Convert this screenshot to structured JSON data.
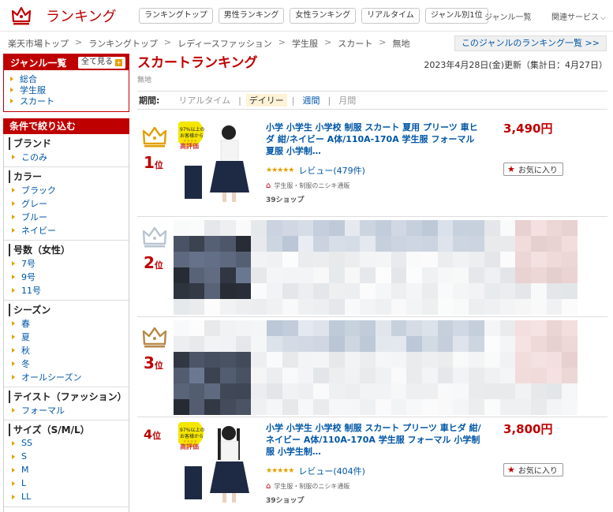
{
  "header": {
    "logo_text": "ランキング",
    "tabs": [
      "ランキングトップ",
      "男性ランキング",
      "女性ランキング",
      "リアルタイム",
      "ジャンル別1位"
    ],
    "genre_list_link": "ジャンル一覧",
    "related_services": "関連サービス"
  },
  "breadcrumb": [
    "楽天市場トップ",
    "ランキングトップ",
    "レディースファッション",
    "学生服",
    "スカート",
    "無地"
  ],
  "genre_ranking_link": "このジャンルのランキング一覧 >>",
  "sidebar": {
    "genre_title": "ジャンル一覧",
    "see_all": "全て見る",
    "genres": [
      "総合",
      "学生服",
      "スカート"
    ],
    "filter_title": "条件で絞り込む",
    "groups": [
      {
        "title": "ブランド",
        "items": [
          "このみ"
        ]
      },
      {
        "title": "カラー",
        "items": [
          "ブラック",
          "グレー",
          "ブルー",
          "ネイビー"
        ]
      },
      {
        "title": "号数（女性）",
        "items": [
          "7号",
          "9号",
          "11号"
        ]
      },
      {
        "title": "シーズン",
        "items": [
          "春",
          "夏",
          "秋",
          "冬",
          "オールシーズン"
        ]
      },
      {
        "title": "テイスト（ファッション）",
        "items": [
          "フォーマル"
        ]
      },
      {
        "title": "サイズ（S/M/L）",
        "items": [
          "SS",
          "S",
          "M",
          "L",
          "LL"
        ]
      }
    ]
  },
  "main": {
    "title": "スカートランキング",
    "updated": "2023年4月28日(金)更新（集計日：4月27日）",
    "subgenre": "無地",
    "period_label": "期間:",
    "periods": [
      "リアルタイム",
      "デイリー",
      "週間",
      "月間"
    ],
    "active_period": "デイリー"
  },
  "items": [
    {
      "rank": "1",
      "rank_suffix": "位",
      "title": "小学 小学生 小学校 制服 スカート 夏用 プリーツ 車ヒダ 紺/ネイビー A体/110A-170A 学生服 フォーマル 夏服 小学制…",
      "price": "3,490円",
      "rating_stars": "★★★★★",
      "reviews": "レビュー(479件)",
      "shop": "学生服・制服のニシキ通販",
      "points": "39ショップ",
      "fav": "お気に入り",
      "thumb_badge": "97%以上のお客様から高評価",
      "crown_color": "#e1a000"
    },
    {
      "rank": "2",
      "rank_suffix": "位",
      "crown_color": "#b8c4d0"
    },
    {
      "rank": "3",
      "rank_suffix": "位",
      "crown_color": "#b7894a"
    },
    {
      "rank": "4",
      "rank_suffix": "位",
      "title": "小学 小学生 小学校 制服 スカート プリーツ 車ヒダ 紺/ネイビー A体/110A-170A 学生服 フォーマル 小学制服 小学生制…",
      "price": "3,800円",
      "rating_stars": "★★★★★",
      "reviews": "レビュー(404件)",
      "shop": "学生服・制服のニシキ通販",
      "points": "39ショップ",
      "fav": "お気に入り",
      "thumb_badge": "97%以上のお客様から高評価"
    }
  ],
  "colors": {
    "brand_red": "#bf0000",
    "link_blue": "#0056a6",
    "star_gold": "#e1a000"
  }
}
